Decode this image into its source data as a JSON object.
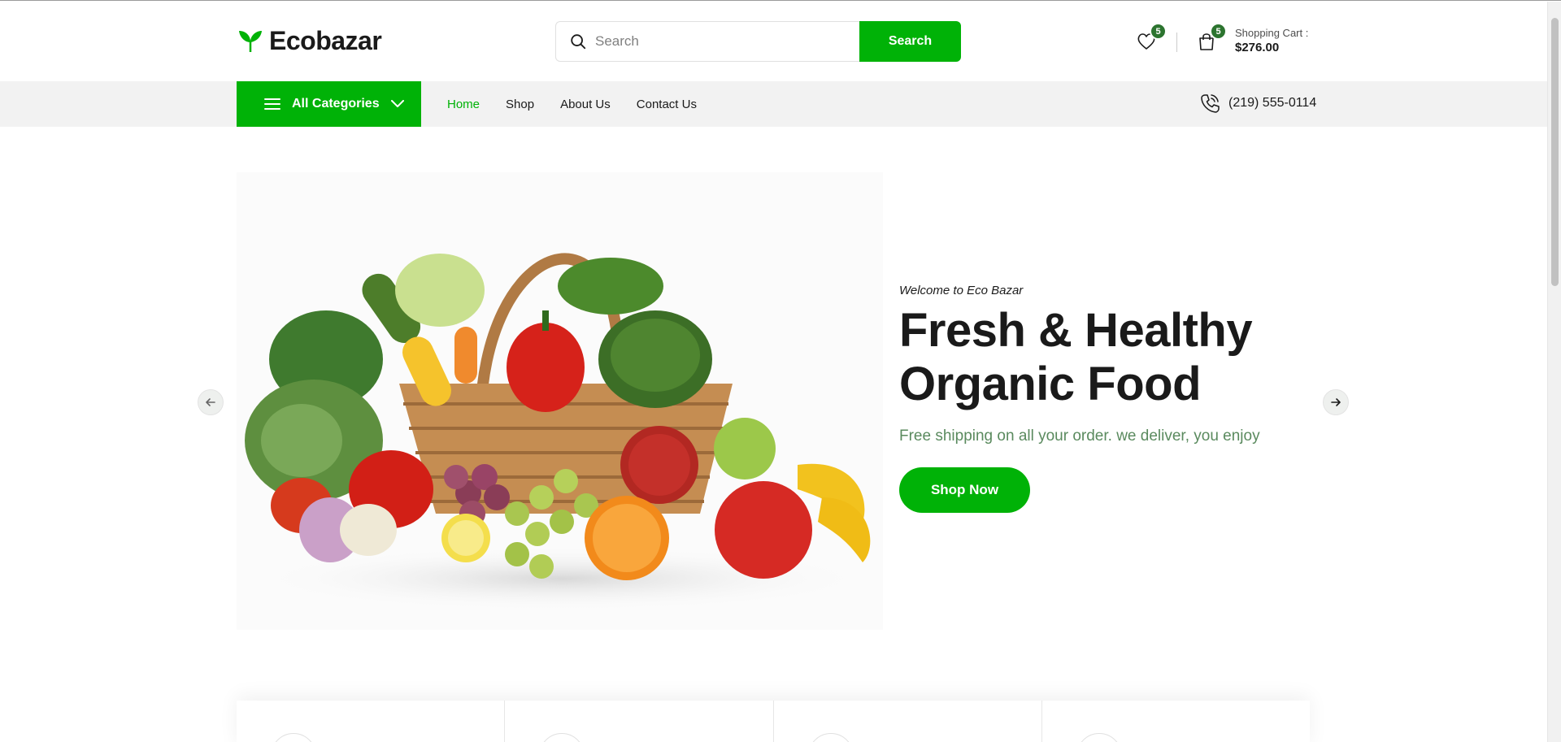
{
  "header": {
    "logo_text": "Ecobazar",
    "search": {
      "placeholder": "Search",
      "value": "",
      "button_label": "Search"
    },
    "wishlist": {
      "count": "5"
    },
    "cart": {
      "count": "5",
      "label": "Shopping Cart :",
      "total": "$276.00"
    }
  },
  "nav": {
    "categories_label": "All Categories",
    "items": [
      {
        "label": "Home",
        "active": true
      },
      {
        "label": "Shop"
      },
      {
        "label": "About Us"
      },
      {
        "label": "Contact Us"
      }
    ],
    "phone": "(219) 555-0114"
  },
  "hero": {
    "welcome": "Welcome to Eco Bazar",
    "headline_line1": "Fresh & Healthy",
    "headline_line2": "Organic Food",
    "subtitle": "Free shipping on all your order. we deliver, you enjoy",
    "button_label": "Shop Now"
  },
  "colors": {
    "brand_green": "#00b207",
    "badge_green": "#2c742f",
    "nav_bg": "#f2f2f2"
  }
}
